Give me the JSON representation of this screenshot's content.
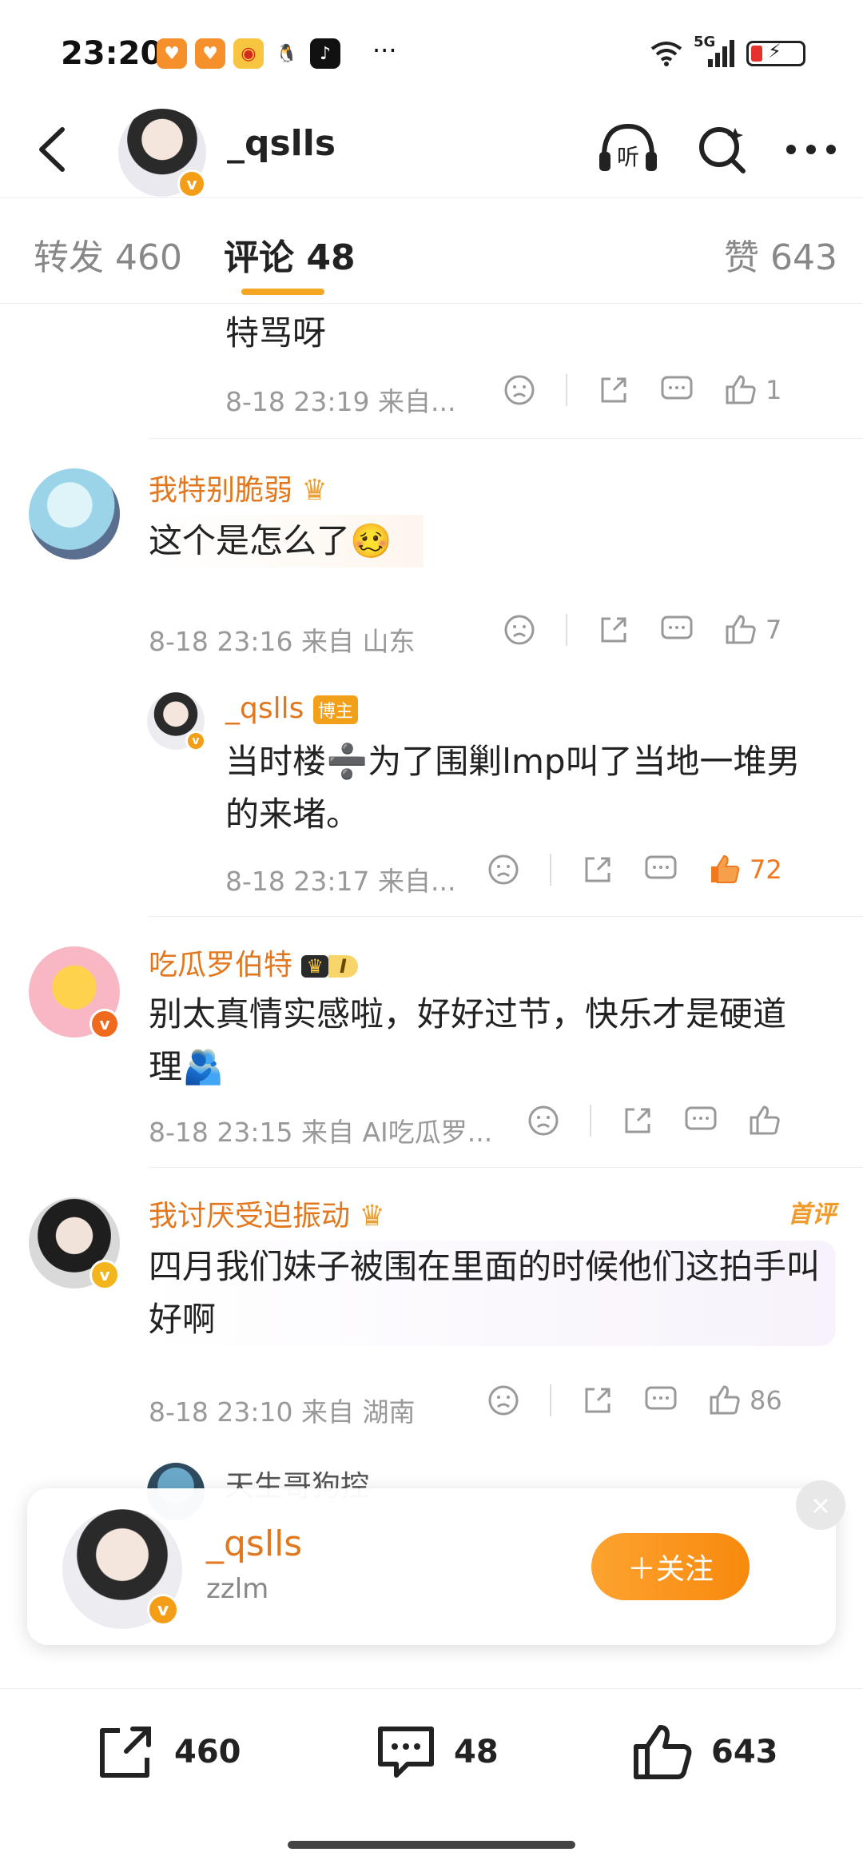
{
  "status_bar": {
    "time": "23:20",
    "more": "···",
    "network": "5G"
  },
  "header": {
    "title": "_qslls"
  },
  "tabs": {
    "repost_label": "转发",
    "repost_count": "460",
    "comment_label": "评论",
    "comment_count": "48",
    "like_label": "赞",
    "like_count": "643"
  },
  "comments": [
    {
      "text": "特骂呀",
      "meta": "8-18 23:19 来自...",
      "likes": "1"
    },
    {
      "name": "我特别脆弱",
      "text": "这个是怎么了🥴",
      "meta": "8-18 23:16 来自 山东",
      "likes": "7"
    },
    {
      "name": "_qslls",
      "badge": "博主",
      "text": "当时楼➗为了围剿lmp叫了当地一堆男的来堵。",
      "meta": "8-18 23:17 来自...",
      "likes": "72"
    },
    {
      "name": "吃瓜罗伯特",
      "level": "I",
      "text": "别太真情实感啦，好好过节，快乐才是硬道理🫂",
      "meta": "8-18 23:15 来自 AI吃瓜罗...",
      "likes": ""
    },
    {
      "name": "我讨厌受迫振动",
      "tag": "首评",
      "text": "四月我们妹子被围在里面的时候他们这拍手叫好啊",
      "meta": "8-18 23:10 来自 湖南",
      "likes": "86"
    },
    {
      "name": "天生哥狗控"
    }
  ],
  "follow_card": {
    "name": "_qslls",
    "sub": "zzlm",
    "button": "＋关注",
    "close": "×"
  },
  "bottom_bar": {
    "reposts": "460",
    "comments": "48",
    "likes": "643"
  },
  "colors": {
    "accent": "#f5a623",
    "name": "#e2771d",
    "liked": "#f0781e"
  }
}
